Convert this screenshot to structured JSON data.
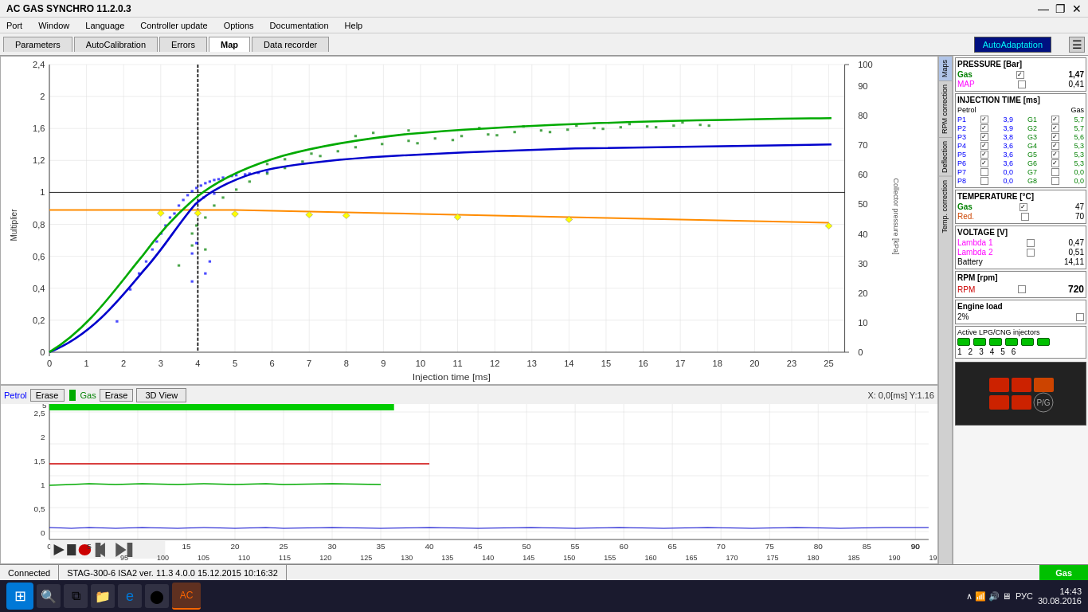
{
  "titlebar": {
    "title": "AC GAS SYNCHRO 11.2.0.3",
    "minimize": "—",
    "maximize": "❐",
    "close": "✕"
  },
  "menubar": {
    "items": [
      "Port",
      "Window",
      "Language",
      "Controller update",
      "Options",
      "Documentation",
      "Help"
    ]
  },
  "tabs": {
    "items": [
      "Parameters",
      "AutoCalibration",
      "Errors",
      "Map",
      "Data recorder"
    ],
    "active": "Map",
    "autoadaptation": "AutoAdaptation"
  },
  "chart": {
    "x_label": "Injection time [ms]",
    "y_left_label": "Multiplier",
    "y_right_label1": "Collector pressure [kPa]",
    "x_axis_max": "25",
    "y_axis_max": "2,4",
    "coords": "X:  0,0[ms] Y:1.16"
  },
  "bottom_buttons": {
    "petrol": "Petrol",
    "erase1": "Erase",
    "gas": "Gas",
    "erase2": "Erase",
    "threed": "3D View"
  },
  "map_sidebar": {
    "items": [
      "Maps",
      "RPM correction",
      "Deflection",
      "Temp. correction"
    ]
  },
  "right_panel": {
    "pressure_title": "PRESSURE [Bar]",
    "gas_label": "Gas",
    "gas_value": "1,47",
    "map_label": "MAP",
    "map_value": "0,41",
    "injection_title": "INJECTION TIME [ms]",
    "petrol_label": "Petrol",
    "gas_label2": "Gas",
    "injectors": [
      {
        "id": "P1",
        "petrol_checked": true,
        "petrol_val": "3,9",
        "g_id": "G1",
        "gas_checked": true,
        "gas_val": "5,7"
      },
      {
        "id": "P2",
        "petrol_checked": true,
        "petrol_val": "3,9",
        "g_id": "G2",
        "gas_checked": true,
        "gas_val": "5,7"
      },
      {
        "id": "P3",
        "petrol_checked": true,
        "petrol_val": "3,8",
        "g_id": "G3",
        "gas_checked": true,
        "gas_val": "5,6"
      },
      {
        "id": "P4",
        "petrol_checked": true,
        "petrol_val": "3,6",
        "g_id": "G4",
        "gas_checked": true,
        "gas_val": "5,3"
      },
      {
        "id": "P5",
        "petrol_checked": true,
        "petrol_val": "3,6",
        "g_id": "G5",
        "gas_checked": true,
        "gas_val": "5,3"
      },
      {
        "id": "P6",
        "petrol_checked": true,
        "petrol_val": "3,6",
        "g_id": "G6",
        "gas_checked": true,
        "gas_val": "5,3"
      },
      {
        "id": "P7",
        "petrol_checked": false,
        "petrol_val": "0,0",
        "g_id": "G7",
        "gas_checked": false,
        "gas_val": "0,0"
      },
      {
        "id": "P8",
        "petrol_checked": false,
        "petrol_val": "0,0",
        "g_id": "G8",
        "gas_checked": false,
        "gas_val": "0,0"
      }
    ],
    "temperature_title": "TEMPERATURE [°C]",
    "gas_temp_label": "Gas",
    "gas_temp_checked": true,
    "gas_temp_value": "47",
    "red_temp_label": "Red.",
    "red_temp_checked": false,
    "red_temp_value": "70",
    "voltage_title": "VOLTAGE [V]",
    "lambda1_label": "Lambda 1",
    "lambda1_checked": false,
    "lambda1_value": "0,47",
    "lambda2_label": "Lambda 2",
    "lambda2_checked": false,
    "lambda2_value": "0,51",
    "battery_label": "Battery",
    "battery_value": "14,11",
    "rpm_title": "RPM [rpm]",
    "rpm_label": "RPM",
    "rpm_checked": false,
    "rpm_value": "720",
    "engine_load_title": "Engine load",
    "engine_load_value": "2%",
    "engine_load_checked": false,
    "injectors_title": "Active LPG/CNG injectors",
    "injector_count": [
      "1",
      "2",
      "3",
      "4",
      "5",
      "6"
    ]
  },
  "status_bar": {
    "connected": "Connected",
    "info": "STAG-300-6 ISA2  ver. 11.3  4.0.0   15.12.2015 10:16:32",
    "gas": "Gas"
  },
  "taskbar": {
    "time": "14:43",
    "date": "30.08.2016",
    "language": "РУС"
  }
}
